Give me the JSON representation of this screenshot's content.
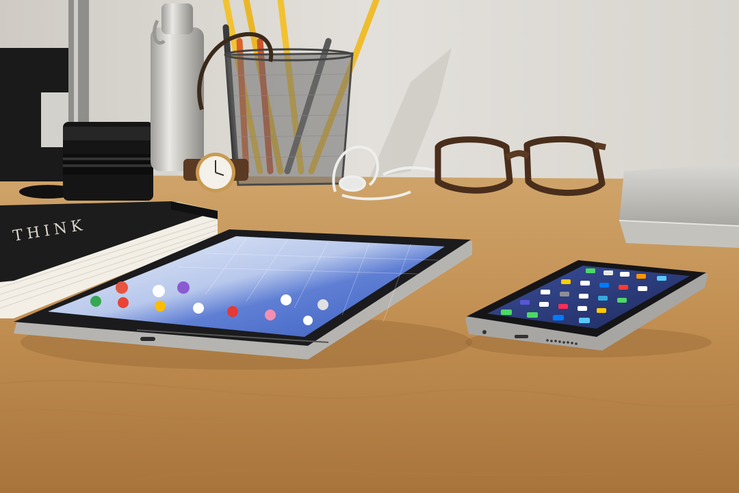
{
  "scene": {
    "kind": "desk-photo",
    "objects": [
      "camera-lens",
      "water-bottle",
      "pencil-cup",
      "wrist-watch",
      "earphones",
      "eyeglasses",
      "laptop",
      "notebook",
      "tablet",
      "smartphone"
    ]
  },
  "notebook": {
    "cover_text": "THINK"
  },
  "colors": {
    "wall": "#dedbd6",
    "desk": "#c99a5e",
    "desk_dark": "#a9773f",
    "tablet_screen": "#6f8fd8",
    "phone_screen": "#2a3a7a",
    "pencil_yellow": "#f2c230",
    "pencil_orange": "#d9622b"
  }
}
